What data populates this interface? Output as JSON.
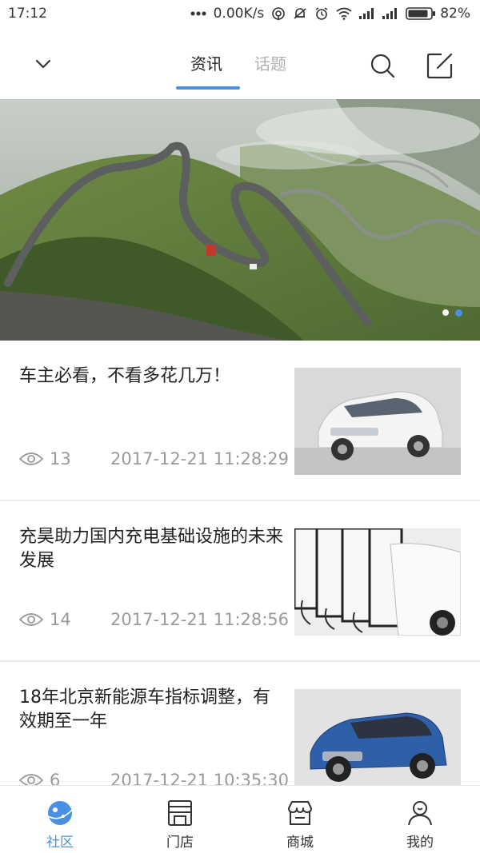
{
  "status_bar": {
    "time": "17:12",
    "network_speed": "0.00K/s",
    "battery": "82%"
  },
  "top_nav": {
    "tabs": [
      {
        "label": "资讯",
        "active": true
      },
      {
        "label": "话题",
        "active": false
      }
    ]
  },
  "banner": {
    "slide_count": 2,
    "active_index": 1
  },
  "articles": [
    {
      "title": "车主必看，不看多花几万！",
      "views": "13",
      "date": "2017-12-21 11:28:29",
      "thumb": "white-car"
    },
    {
      "title": "充昊助力国内充电基础设施的未来发展",
      "views": "14",
      "date": "2017-12-21 11:28:56",
      "thumb": "charging-cars"
    },
    {
      "title": "18年北京新能源车指标调整，有效期至一年",
      "views": "6",
      "date": "2017-12-21 10:35:30",
      "thumb": "blue-suv"
    }
  ],
  "bottom_nav": {
    "items": [
      {
        "label": "社区",
        "icon": "planet-icon",
        "active": true
      },
      {
        "label": "门店",
        "icon": "store-icon",
        "active": false
      },
      {
        "label": "商城",
        "icon": "shop-icon",
        "active": false
      },
      {
        "label": "我的",
        "icon": "profile-icon",
        "active": false
      }
    ]
  },
  "colors": {
    "accent": "#4a90e2",
    "muted_text": "#9a9a9a",
    "inactive_tab": "#b0b0b0"
  }
}
